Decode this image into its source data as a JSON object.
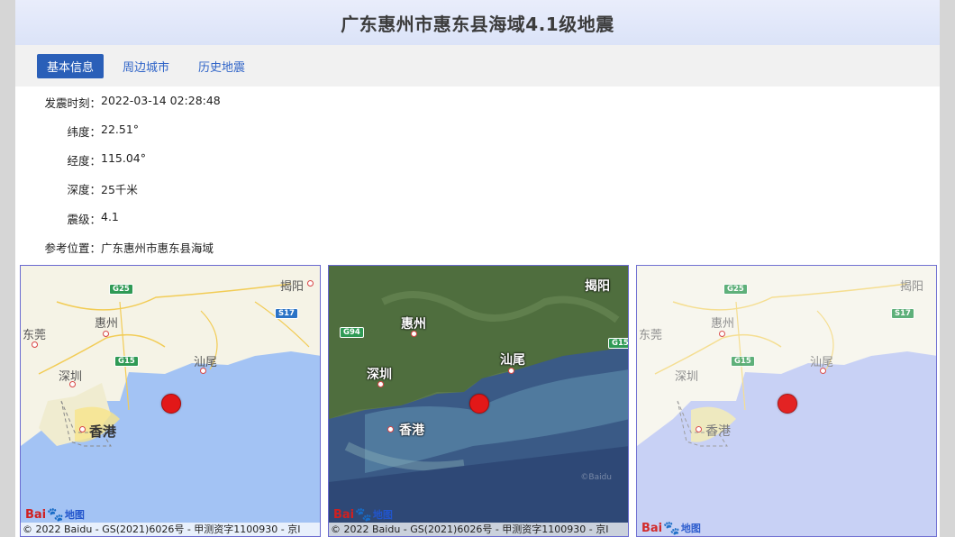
{
  "title": "广东惠州市惠东县海域4.1级地震",
  "tabs": [
    {
      "label": "基本信息",
      "active": true
    },
    {
      "label": "周边城市",
      "active": false
    },
    {
      "label": "历史地震",
      "active": false
    }
  ],
  "info": {
    "time_label": "发震时刻：",
    "time_value": "2022-03-14 02:28:48",
    "lat_label": "纬度：",
    "lat_value": "22.51°",
    "lon_label": "经度：",
    "lon_value": "115.04°",
    "depth_label": "深度：",
    "depth_value": "25千米",
    "mag_label": "震级：",
    "mag_value": "4.1",
    "loc_label": "参考位置：",
    "loc_value": "广东惠州市惠东县海域"
  },
  "maps": {
    "cities": {
      "jieyang": "揭阳",
      "huizhou": "惠州",
      "dongguan": "东莞",
      "shenzhen": "深圳",
      "shanwei": "汕尾",
      "hongkong": "香港"
    },
    "roads": {
      "g25": "G25",
      "s17": "S17",
      "g15": "G15",
      "g94": "G94"
    },
    "logo_text": "Bai",
    "logo_suffix": "地图",
    "satellite_watermark": "©Baidu",
    "copyright": "© 2022 Baidu - GS(2021)6026号 - 甲测资字1100930 - 京I"
  },
  "colors": {
    "accent": "#2a5fb8",
    "quake_marker": "#e21818",
    "sea": "#a4c4f4",
    "land": "#f5f3e8"
  }
}
